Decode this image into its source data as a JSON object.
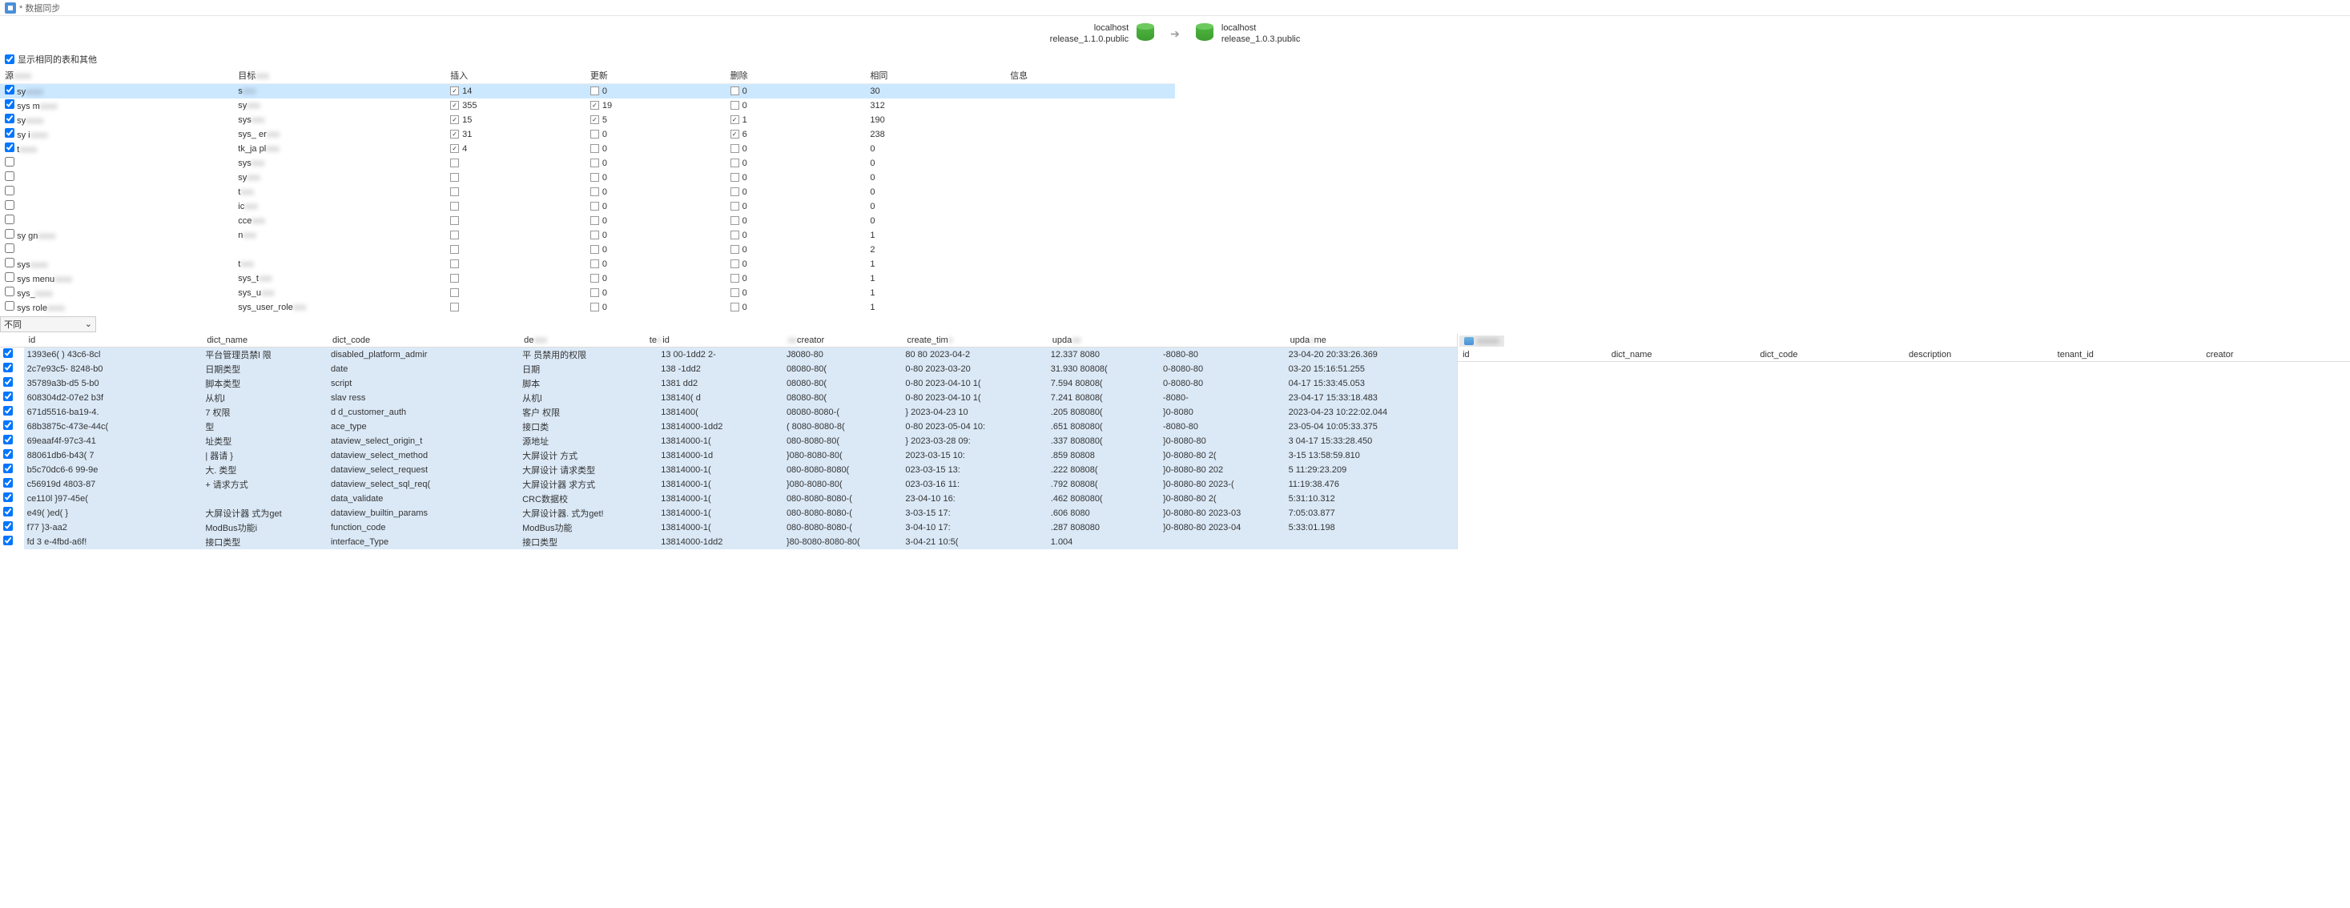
{
  "titlebar": {
    "text": "* 数据同步"
  },
  "header": {
    "source": {
      "host": "localhost",
      "db": "release_1.1.0.public"
    },
    "target": {
      "host": "localhost",
      "db": "release_1.0.3.public"
    }
  },
  "showSameLabel": "显示相同的表和其他",
  "syncColumns": {
    "source": "源",
    "target": "目标",
    "insert": "插入",
    "update": "更新",
    "delete": "删除",
    "same": "相同",
    "info": "信息"
  },
  "syncRows": [
    {
      "sel": true,
      "src": "sy",
      "tgt": "s",
      "ins": "14",
      "insC": true,
      "upd": "0",
      "updC": false,
      "del": "0",
      "delC": false,
      "same": "30",
      "selected": true
    },
    {
      "sel": true,
      "src": "sys          m",
      "tgt": "sy",
      "ins": "355",
      "insC": true,
      "upd": "19",
      "updC": true,
      "del": "0",
      "delC": false,
      "same": "312"
    },
    {
      "sel": true,
      "src": "sy",
      "tgt": "sys",
      "ins": "15",
      "insC": true,
      "upd": "5",
      "updC": true,
      "del": "1",
      "delC": true,
      "same": "190"
    },
    {
      "sel": true,
      "src": "sy             i",
      "tgt": "sys_           er",
      "ins": "31",
      "insC": true,
      "upd": "0",
      "updC": false,
      "del": "6",
      "delC": true,
      "same": "238"
    },
    {
      "sel": true,
      "src": "t",
      "tgt": "tk_ja        pl",
      "ins": "4",
      "insC": true,
      "upd": "0",
      "updC": false,
      "del": "0",
      "delC": false,
      "same": "0"
    },
    {
      "sel": false,
      "src": "",
      "tgt": "sys",
      "ins": "",
      "insC": false,
      "upd": "0",
      "updC": false,
      "del": "0",
      "delC": false,
      "same": "0"
    },
    {
      "sel": false,
      "src": "",
      "tgt": "sy",
      "ins": "",
      "insC": false,
      "upd": "0",
      "updC": false,
      "del": "0",
      "delC": false,
      "same": "0"
    },
    {
      "sel": false,
      "src": "",
      "tgt": "t",
      "ins": "",
      "insC": false,
      "upd": "0",
      "updC": false,
      "del": "0",
      "delC": false,
      "same": "0"
    },
    {
      "sel": false,
      "src": "",
      "tgt": "       ic",
      "ins": "",
      "insC": false,
      "upd": "0",
      "updC": false,
      "del": "0",
      "delC": false,
      "same": "0"
    },
    {
      "sel": false,
      "src": "",
      "tgt": "      cce",
      "ins": "",
      "insC": false,
      "upd": "0",
      "updC": false,
      "del": "0",
      "delC": false,
      "same": "0"
    },
    {
      "sel": false,
      "src": "sy             gn",
      "tgt": "                   n",
      "ins": "",
      "insC": false,
      "upd": "0",
      "updC": false,
      "del": "0",
      "delC": false,
      "same": "1"
    },
    {
      "sel": false,
      "src": "",
      "tgt": "",
      "ins": "",
      "insC": false,
      "upd": "0",
      "updC": false,
      "del": "0",
      "delC": false,
      "same": "2"
    },
    {
      "sel": false,
      "src": "sys",
      "tgt": "     t",
      "ins": "",
      "insC": false,
      "upd": "0",
      "updC": false,
      "del": "0",
      "delC": false,
      "same": "1"
    },
    {
      "sel": false,
      "src": "sys         menu",
      "tgt": "sys_t",
      "ins": "",
      "insC": false,
      "upd": "0",
      "updC": false,
      "del": "0",
      "delC": false,
      "same": "1"
    },
    {
      "sel": false,
      "src": "sys_",
      "tgt": "sys_u",
      "ins": "",
      "insC": false,
      "upd": "0",
      "updC": false,
      "del": "0",
      "delC": false,
      "same": "1"
    },
    {
      "sel": false,
      "src": "sys      role",
      "tgt": "sys_user_role",
      "ins": "",
      "insC": false,
      "upd": "0",
      "updC": false,
      "del": "0",
      "delC": false,
      "same": "1"
    }
  ],
  "filterLabel": "不同",
  "detailColumns": [
    "id",
    "dict_name",
    "dict_code",
    "de",
    "te",
    "id",
    "creator",
    "create_tim",
    "upda",
    "upda",
    "me"
  ],
  "detailRows": [
    {
      "id": "1393e6(       )  43c6-8cl",
      "dict_name": "平台管理员禁l      限",
      "dict_code": "disabled_platform_admir",
      "de": "平    员禁用的权限",
      "te": "",
      "id2": "13  00-1dd2   2-",
      "creator": "J8080-80",
      "create_tim": "80  80 2023-04-2",
      "upda": "12.337 8080",
      "upda2": "-8080-80",
      "me": "23-04-20 20:33:26.369"
    },
    {
      "id": "2c7e93c5-    8248-b0",
      "dict_name": "日期类型",
      "dict_code": "date",
      "de": "日期",
      "te": "",
      "id2": "138    -1dd2",
      "creator": "08080-80(",
      "create_tim": "0-80 2023-03-20",
      "upda": "31.930 80808(",
      "upda2": "0-8080-80",
      "me": "03-20 15:16:51.255"
    },
    {
      "id": "35789a3b-d5   5-b0",
      "dict_name": "脚本类型",
      "dict_code": "script",
      "de": "脚本",
      "te": "",
      "id2": "1381    dd2",
      "creator": "08080-80(",
      "create_tim": "0-80 2023-04-10 1(",
      "upda": "7.594 80808(",
      "upda2": "0-8080-80",
      "me": "04-17 15:33:45.053"
    },
    {
      "id": "608304d2-07e2     b3f",
      "dict_name": "从机l",
      "dict_code": "slav       ress",
      "de": "从机l",
      "te": "",
      "id2": "138140(    d",
      "creator": "08080-80(",
      "create_tim": "0-80 2023-04-10 1(",
      "upda": "7.241 80808(",
      "upda2": "-8080-",
      "me": "23-04-17 15:33:18.483"
    },
    {
      "id": "671d5516-ba19-4.",
      "dict_name": "    7    权限",
      "dict_code": "d       d_customer_auth",
      "de": "客户   权限",
      "te": "",
      "id2": "1381400(",
      "creator": "08080-8080-(",
      "create_tim": "} 2023-04-23 10",
      "upda": ".205 808080(",
      "upda2": "}0-8080",
      "me": "2023-04-23 10:22:02.044"
    },
    {
      "id": "68b3875c-473e-44c(",
      "dict_name": "   型",
      "dict_code": "       ace_type",
      "de": "接口类",
      "te": "",
      "id2": "13814000-1dd2",
      "creator": "(    8080-8080-8(",
      "create_tim": "0-80 2023-05-04 10:",
      "upda": ".651 808080(",
      "upda2": "-8080-80",
      "me": "23-05-04 10:05:33.375"
    },
    {
      "id": "69eaaf4f-97c3-41",
      "dict_name": "    址类型",
      "dict_code": "   ataview_select_origin_t",
      "de": "源地址",
      "te": "",
      "id2": "13814000-1(",
      "creator": "080-8080-80(",
      "create_tim": "} 2023-03-28 09:",
      "upda": ".337 808080(",
      "upda2": "}0-8080-80",
      "me": "3  04-17 15:33:28.450"
    },
    {
      "id": "88061db6-b43(        7",
      "dict_name": "|  器请   }",
      "dict_code": "dataview_select_method",
      "de": "大屏设计   方式",
      "te": "",
      "id2": "13814000-1d",
      "creator": "}080-8080-80(",
      "create_tim": "2023-03-15 10:",
      "upda": ".859 80808",
      "upda2": "}0-8080-80 2(",
      "me": "3-15 13:58:59.810"
    },
    {
      "id": "b5c70dc6-6    99-9e",
      "dict_name": "大.           类型",
      "dict_code": "dataview_select_request",
      "de": "大屏设计    请求类型",
      "te": "",
      "id2": "13814000-1(",
      "creator": "080-8080-8080(",
      "create_tim": "023-03-15 13:",
      "upda": ".222 80808(",
      "upda2": "}0-8080-80 202",
      "me": "5 11:29:23.209"
    },
    {
      "id": "c56919d    4803-87",
      "dict_name": "+    请求方式",
      "dict_code": "dataview_select_sql_req(",
      "de": "大屏设计器    求方式",
      "te": "",
      "id2": "13814000-1(",
      "creator": "}080-8080-80(",
      "create_tim": "023-03-16 11:",
      "upda": ".792 80808(",
      "upda2": "}0-8080-80 2023-(",
      "me": "11:19:38.476"
    },
    {
      "id": "ce110l    }97-45e(",
      "dict_name": "",
      "dict_code": "data_validate",
      "de": "CRC数据校",
      "te": "",
      "id2": "13814000-1(",
      "creator": "080-8080-8080-(",
      "create_tim": "23-04-10 16:",
      "upda": ".462 808080(",
      "upda2": "}0-8080-80 2(",
      "me": "5:31:10.312"
    },
    {
      "id": "e49(   )ed(         }",
      "dict_name": " 大屏设计器    式为get",
      "dict_code": "dataview_builtin_params",
      "de": "大屏设计器.    式为get!",
      "te": "",
      "id2": "13814000-1(",
      "creator": "080-8080-8080-(",
      "create_tim": "3-03-15 17:",
      "upda": ".606 8080",
      "upda2": "}0-8080-80 2023-03",
      "me": "7:05:03.877"
    },
    {
      "id": "f77      }3-aa2",
      "dict_name": "ModBus功能i",
      "dict_code": "function_code",
      "de": "ModBus功能",
      "te": "",
      "id2": "13814000-1(",
      "creator": "080-8080-8080-(",
      "create_tim": "3-04-10 17:",
      "upda": ".287 808080",
      "upda2": "}0-8080-80 2023-04",
      "me": "5:33:01.198"
    },
    {
      "id": "fd   3      e-4fbd-a6f!",
      "dict_name": "接口类型",
      "dict_code": "interface_Type",
      "de": "接口类型",
      "te": "",
      "id2": "13814000-1dd2",
      "creator": "}80-8080-8080-80(",
      "create_tim": "3-04-21 10:5(",
      "upda": "1.004",
      "upda2": "",
      "me": ""
    }
  ],
  "rightColumns": [
    "id",
    "dict_name",
    "dict_code",
    "description",
    "tenant_id",
    "creator"
  ]
}
